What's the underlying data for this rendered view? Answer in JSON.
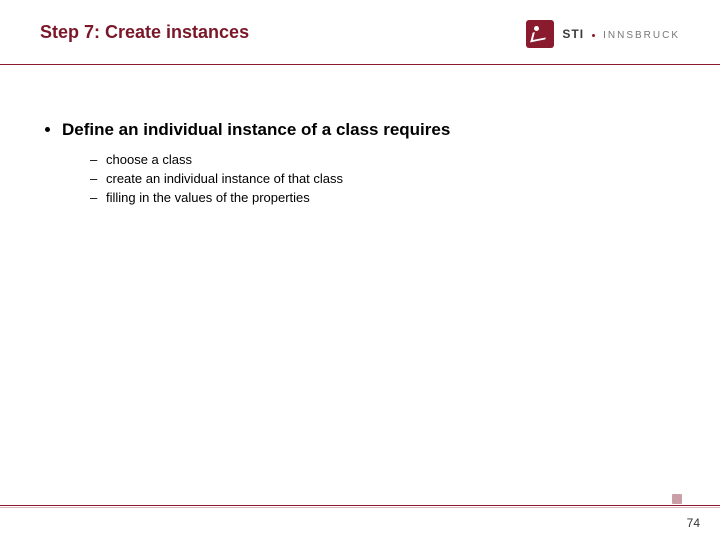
{
  "header": {
    "title": "Step 7: Create instances",
    "logo": {
      "primary": "STI",
      "secondary": "INNSBRUCK"
    }
  },
  "content": {
    "main_bullet": "Define an individual instance of a class requires",
    "sub_bullets": [
      "choose a class",
      "create an individual instance of that class",
      "filling in the values of the properties"
    ]
  },
  "footer": {
    "page_number": "74"
  },
  "colors": {
    "accent": "#8a1b2e"
  }
}
